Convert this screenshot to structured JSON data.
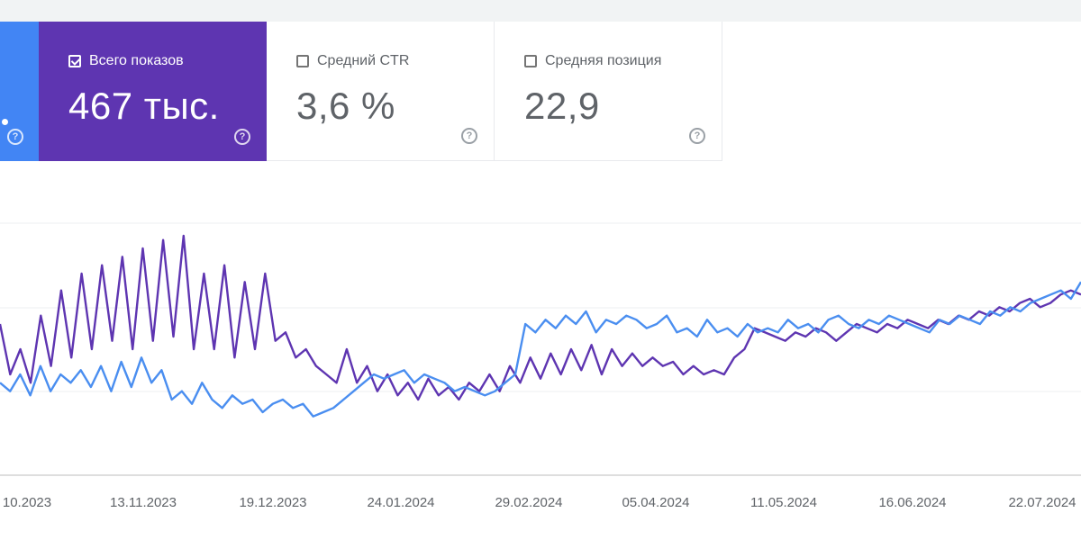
{
  "cards": {
    "impressions": {
      "label": "Всего показов",
      "value": "467 тыс.",
      "checked": true,
      "color": "#5e35b1"
    },
    "ctr": {
      "label": "Средний CTR",
      "value": "3,6 %",
      "checked": false
    },
    "position": {
      "label": "Средняя позиция",
      "value": "22,9",
      "checked": false
    },
    "clicks": {
      "color": "#4285f4",
      "value_fragment": "."
    },
    "help_glyph": "?"
  },
  "chart_data": {
    "type": "line",
    "x_tick_labels": [
      "10.2023",
      "13.11.2023",
      "19.12.2023",
      "24.01.2024",
      "29.02.2024",
      "05.04.2024",
      "11.05.2024",
      "16.06.2024",
      "22.07.2024"
    ],
    "grid": true,
    "series": [
      {
        "color": "#5e35b1",
        "values": [
          180,
          120,
          150,
          110,
          190,
          130,
          220,
          140,
          240,
          150,
          250,
          160,
          260,
          150,
          270,
          160,
          280,
          165,
          285,
          150,
          240,
          150,
          250,
          140,
          230,
          150,
          240,
          160,
          170,
          140,
          150,
          130,
          120,
          110,
          150,
          110,
          130,
          100,
          120,
          95,
          110,
          90,
          115,
          95,
          105,
          90,
          110,
          100,
          120,
          100,
          130,
          110,
          140,
          115,
          145,
          120,
          150,
          125,
          155,
          120,
          150,
          130,
          145,
          130,
          140,
          130,
          135,
          120,
          130,
          120,
          125,
          120,
          140,
          150,
          175,
          170,
          165,
          160,
          170,
          165,
          175,
          170,
          160,
          170,
          180,
          175,
          170,
          180,
          175,
          185,
          180,
          175,
          185,
          180,
          190,
          185,
          195,
          190,
          200,
          195,
          205,
          210,
          200,
          205,
          215,
          220,
          215
        ]
      },
      {
        "color": "#4a8ef0",
        "values": [
          110,
          100,
          120,
          95,
          130,
          100,
          120,
          110,
          125,
          105,
          130,
          100,
          135,
          105,
          140,
          110,
          125,
          90,
          100,
          85,
          110,
          90,
          80,
          95,
          85,
          90,
          75,
          85,
          90,
          80,
          85,
          70,
          75,
          80,
          90,
          100,
          110,
          120,
          115,
          120,
          125,
          110,
          120,
          115,
          110,
          100,
          105,
          100,
          95,
          100,
          110,
          120,
          180,
          170,
          185,
          175,
          190,
          180,
          195,
          170,
          185,
          180,
          190,
          185,
          175,
          180,
          190,
          170,
          175,
          165,
          185,
          170,
          175,
          165,
          180,
          170,
          175,
          170,
          185,
          175,
          180,
          170,
          185,
          190,
          180,
          175,
          185,
          180,
          190,
          185,
          180,
          175,
          170,
          185,
          180,
          190,
          185,
          180,
          195,
          190,
          200,
          195,
          205,
          210,
          215,
          220,
          210,
          230
        ]
      }
    ]
  }
}
